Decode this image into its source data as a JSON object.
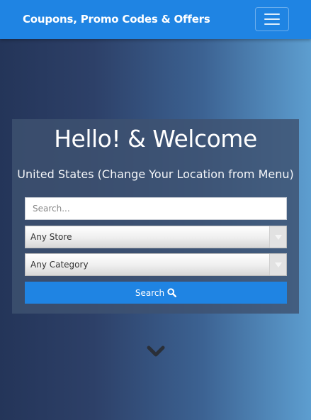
{
  "navbar": {
    "brand": "Coupons, Promo Codes & Offers",
    "menu_icon": "hamburger-menu-icon",
    "color": "#1f84e3"
  },
  "hero": {
    "title": "Hello! & Welcome",
    "location": "United States (Change Your Location from Menu)"
  },
  "search_form": {
    "search_placeholder": "Search...",
    "search_value": "",
    "store_select": {
      "selected": "Any Store"
    },
    "category_select": {
      "selected": "Any Category"
    },
    "submit_label": "Search",
    "submit_icon": "magnifier-icon"
  },
  "scroll_icon": "chevron-down-icon"
}
